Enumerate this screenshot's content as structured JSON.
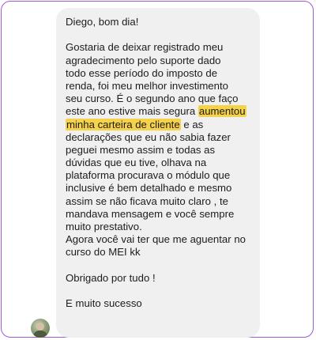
{
  "message": {
    "lines": [
      "Diego, bom dia!",
      "",
      "Gostaria de deixar registrado meu",
      "agradecimento pelo suporte dado",
      "todo esse período do imposto de",
      "renda, foi meu melhor investimento",
      "seu curso.  É o segundo ano que faço"
    ],
    "line7_before": "este ano estive mais segura ",
    "line7_highlight": "aumentou",
    "line8_highlight": "minha carteira de cliente",
    "line8_after": " e as",
    "lines_after": [
      "declarações que eu não sabia fazer",
      "peguei mesmo assim e todas as",
      "dúvidas que eu tive, olhava na",
      "plataforma procurava o módulo que",
      "inclusive é bem detalhado e mesmo",
      "assim se não ficava muito claro , te",
      "mandava mensagem e você sempre",
      "muito prestativo.",
      "Agora você vai ter que me aguentar no",
      "curso do MEI kk",
      "",
      "Obrigado por tudo !",
      "",
      "E muito sucesso"
    ]
  },
  "colors": {
    "frame_border": "#9b59d6",
    "bubble_bg": "#f0f0f0",
    "highlight": "#f6d24a",
    "text": "#1c1c1c"
  },
  "avatar": {
    "icon": "user-avatar-photo"
  }
}
